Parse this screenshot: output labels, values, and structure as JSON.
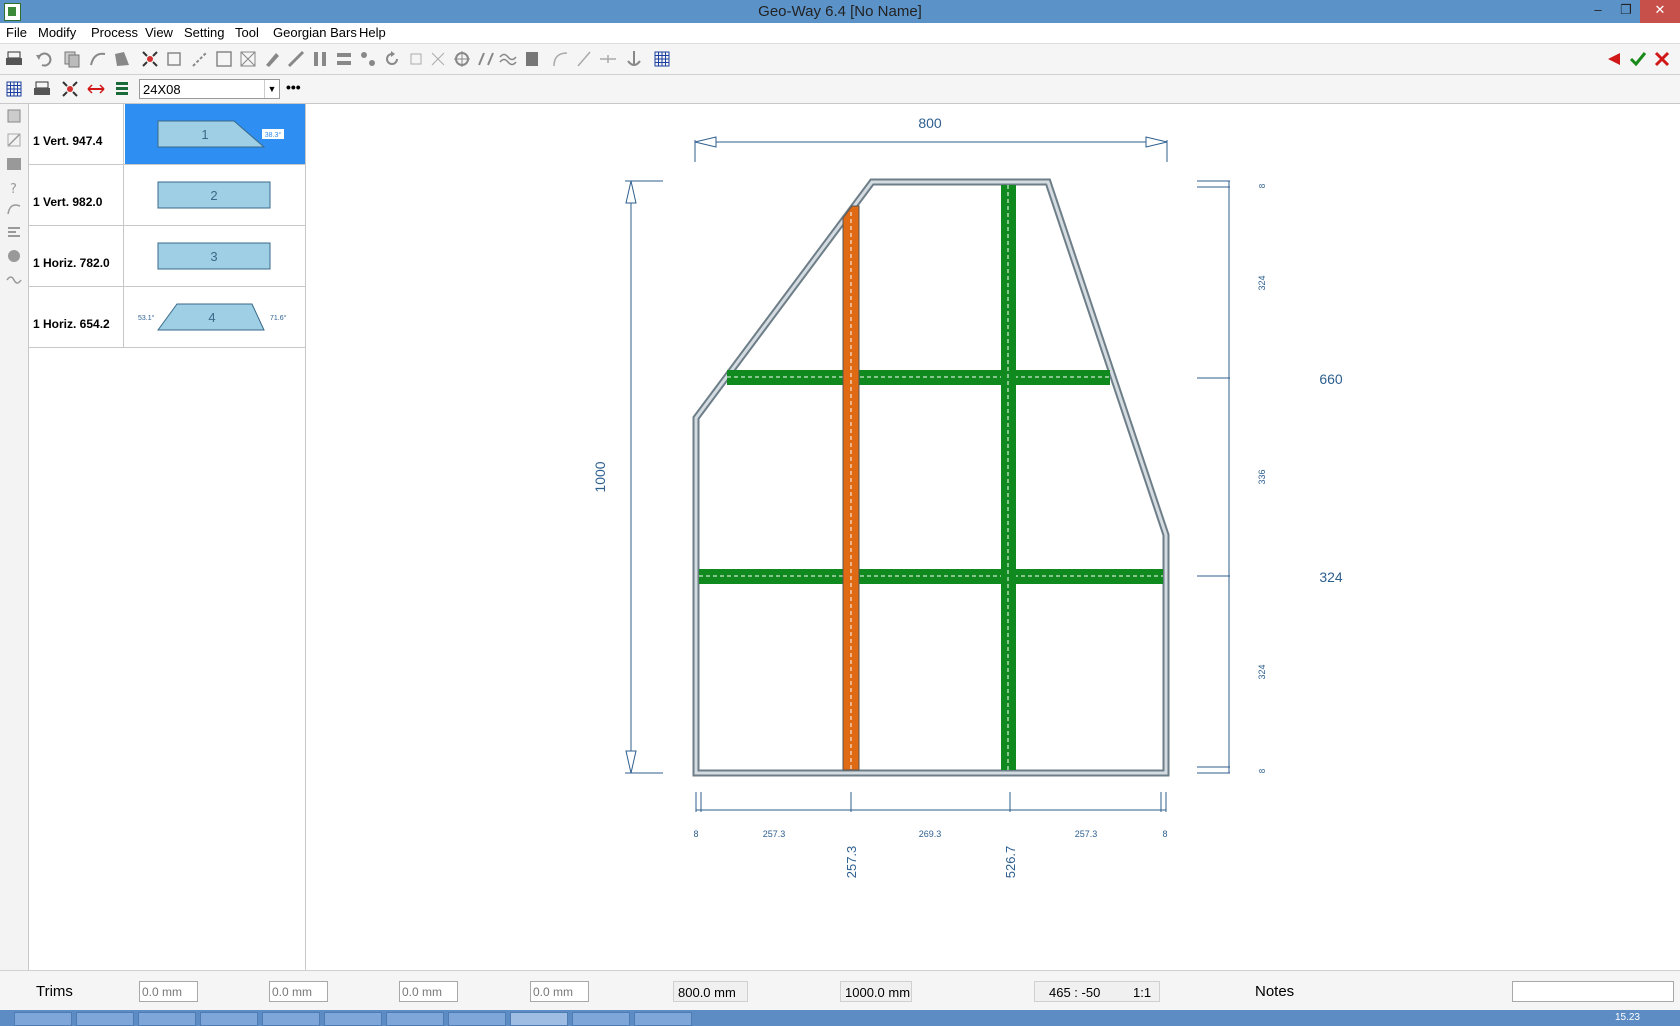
{
  "window": {
    "title": "Geo-Way 6.4  [No Name]"
  },
  "menu": [
    "File",
    "Modify",
    "Process",
    "View",
    "Setting",
    "Tool",
    "Georgian Bars",
    "Help"
  ],
  "combo": {
    "value": "24X08"
  },
  "bars": [
    {
      "label": "1 Vert. 947.4",
      "num": "1",
      "angle_right": "38.3°",
      "angle_left": "",
      "selected": true
    },
    {
      "label": "1 Vert. 982.0",
      "num": "2",
      "angle_right": "",
      "angle_left": "",
      "selected": false
    },
    {
      "label": "1 Horiz. 782.0",
      "num": "3",
      "angle_right": "",
      "angle_left": "",
      "selected": false
    },
    {
      "label": "1 Horiz. 654.2",
      "num": "4",
      "angle_right": "71.6°",
      "angle_left": "53.1°",
      "selected": false
    }
  ],
  "drawing": {
    "width_dim": "800",
    "height_dim": "1000",
    "right_dim_upper": "660",
    "right_dim_lower": "324",
    "right_small": [
      "8",
      "324",
      "336",
      "324",
      "8"
    ],
    "bottom_small": [
      "8",
      "257.3",
      "269.3",
      "257.3",
      "8"
    ],
    "bottom_pos": [
      "257.3",
      "526.7"
    ]
  },
  "status": {
    "trims_label": "Trims",
    "trim_values": [
      "0.0 mm",
      "0.0 mm",
      "0.0 mm",
      "0.0 mm"
    ],
    "width_value": "800.0 mm",
    "height_value": "1000.0 mm",
    "coords": "465 :  -50",
    "scale": "1:1",
    "notes_label": "Notes",
    "notes_value": ""
  },
  "taskbar": {
    "time": "15.23"
  },
  "colors": {
    "titlebar": "#5b93c9",
    "selected": "#2f8ef1",
    "bar_fill": "#9ecfe4",
    "green_bar": "#108a1e",
    "orange_bar": "#e06a14",
    "dim_line": "#2d5f8f"
  }
}
